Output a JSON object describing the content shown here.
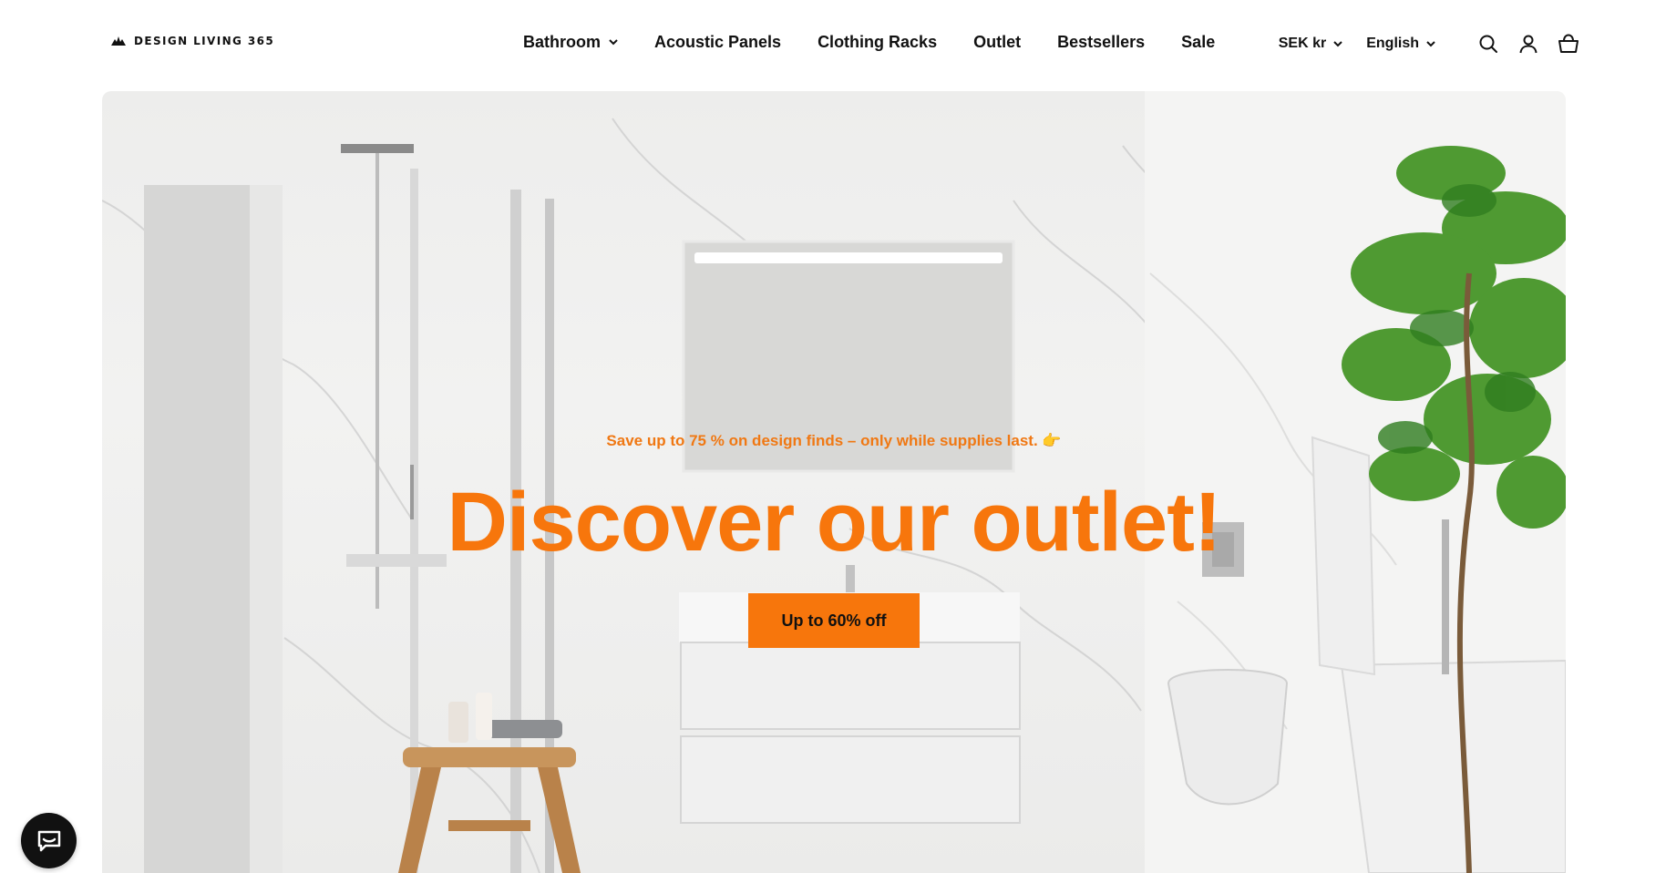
{
  "brand": {
    "name": "DESIGN LIVING 365",
    "logo_icon": "leaf-logo-icon"
  },
  "nav": {
    "items": [
      {
        "label": "Bathroom",
        "has_dropdown": true
      },
      {
        "label": "Acoustic Panels",
        "has_dropdown": false
      },
      {
        "label": "Clothing Racks",
        "has_dropdown": false
      },
      {
        "label": "Outlet",
        "has_dropdown": false
      },
      {
        "label": "Bestsellers",
        "has_dropdown": false
      },
      {
        "label": "Sale",
        "has_dropdown": false
      }
    ]
  },
  "tools": {
    "currency": "SEK kr",
    "language": "English",
    "icons": [
      "search-icon",
      "account-icon",
      "cart-icon"
    ]
  },
  "hero": {
    "subtitle": "Save up to 75 % on design finds – only while supplies last. 👉",
    "title": "Discover our outlet!",
    "cta_label": "Up to 60% off"
  },
  "chat": {
    "icon": "chat-icon"
  },
  "colors": {
    "accent": "#f7760c",
    "text": "#111111",
    "background": "#ffffff"
  }
}
